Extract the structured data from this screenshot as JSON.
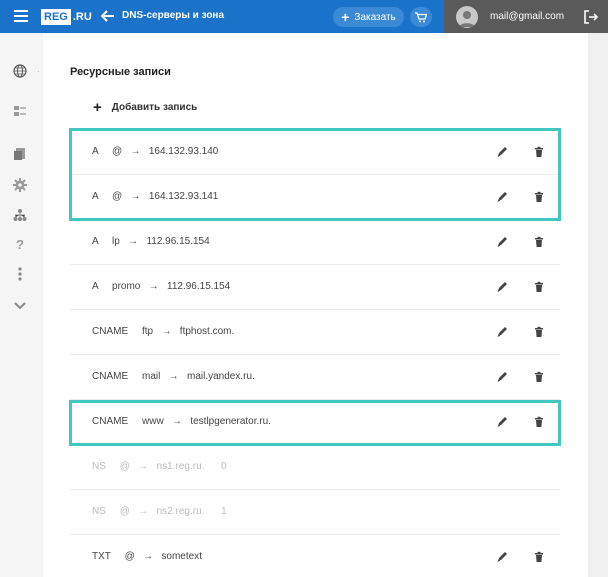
{
  "header": {
    "logo": "REG",
    "logo_suffix": ".RU",
    "breadcrumb": "DNS-серверы и зона",
    "order_label": "Заказать",
    "user_email": "mail@gmail.com"
  },
  "section": {
    "title": "Ресурсные записи",
    "add_label": "Добавить запись"
  },
  "records": [
    {
      "text": "A     @   →   164.132.93.140",
      "editable": true,
      "disabled": false
    },
    {
      "text": "A     @   →   164.132.93.141",
      "editable": true,
      "disabled": false
    },
    {
      "text": "A     lp   →   112.96.15.154",
      "editable": true,
      "disabled": false
    },
    {
      "text": "A     promo   →   112.96.15.154",
      "editable": true,
      "disabled": false
    },
    {
      "text": "CNAME     ftp   →   ftphost.com.",
      "editable": true,
      "disabled": false
    },
    {
      "text": "CNAME     mail   →   mail.yandex.ru.",
      "editable": true,
      "disabled": false
    },
    {
      "text": "CNAME     www   →   testlpgenerator.ru.",
      "editable": true,
      "disabled": false
    },
    {
      "text": "NS     @   →   ns1.reg.ru.      0",
      "editable": false,
      "disabled": true
    },
    {
      "text": "NS     @   →   ns2.reg.ru.      1",
      "editable": false,
      "disabled": true
    },
    {
      "text": "TXT     @   →   sometext",
      "editable": true,
      "disabled": false
    }
  ],
  "colors": {
    "header_bg": "#1a73c8",
    "highlight": "#3fc7c0",
    "user_bar_bg": "#5a5a5a"
  }
}
